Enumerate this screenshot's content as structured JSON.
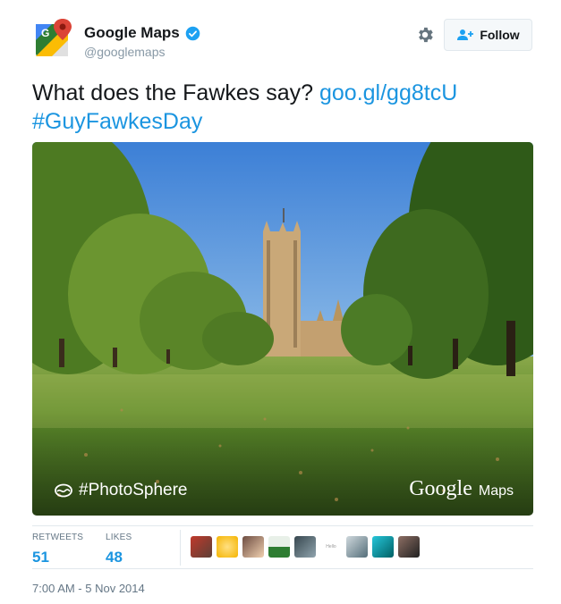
{
  "user": {
    "name": "Google Maps",
    "handle": "@googlemaps",
    "verified": true,
    "avatar_icon": "google-maps-logo-icon"
  },
  "actions": {
    "settings_icon": "gear-icon",
    "follow_label": "Follow",
    "follow_icon": "add-person-icon"
  },
  "tweet": {
    "text": "What does the Fawkes say?",
    "link": "goo.gl/gg8tcU",
    "hashtag": "#GuyFawkesDay"
  },
  "media": {
    "tag": "#PhotoSphere",
    "tag_icon": "photosphere-icon",
    "watermark_brand": "Google",
    "watermark_product": "Maps"
  },
  "stats": {
    "retweets_label": "RETWEETS",
    "retweets_value": "51",
    "likes_label": "LIKES",
    "likes_value": "48"
  },
  "likers": {
    "small_text": "Hello"
  },
  "timestamp": "7:00 AM - 5 Nov 2014",
  "colors": {
    "link": "#1b95e0",
    "verified": "#1da1f2",
    "muted": "#657786"
  }
}
